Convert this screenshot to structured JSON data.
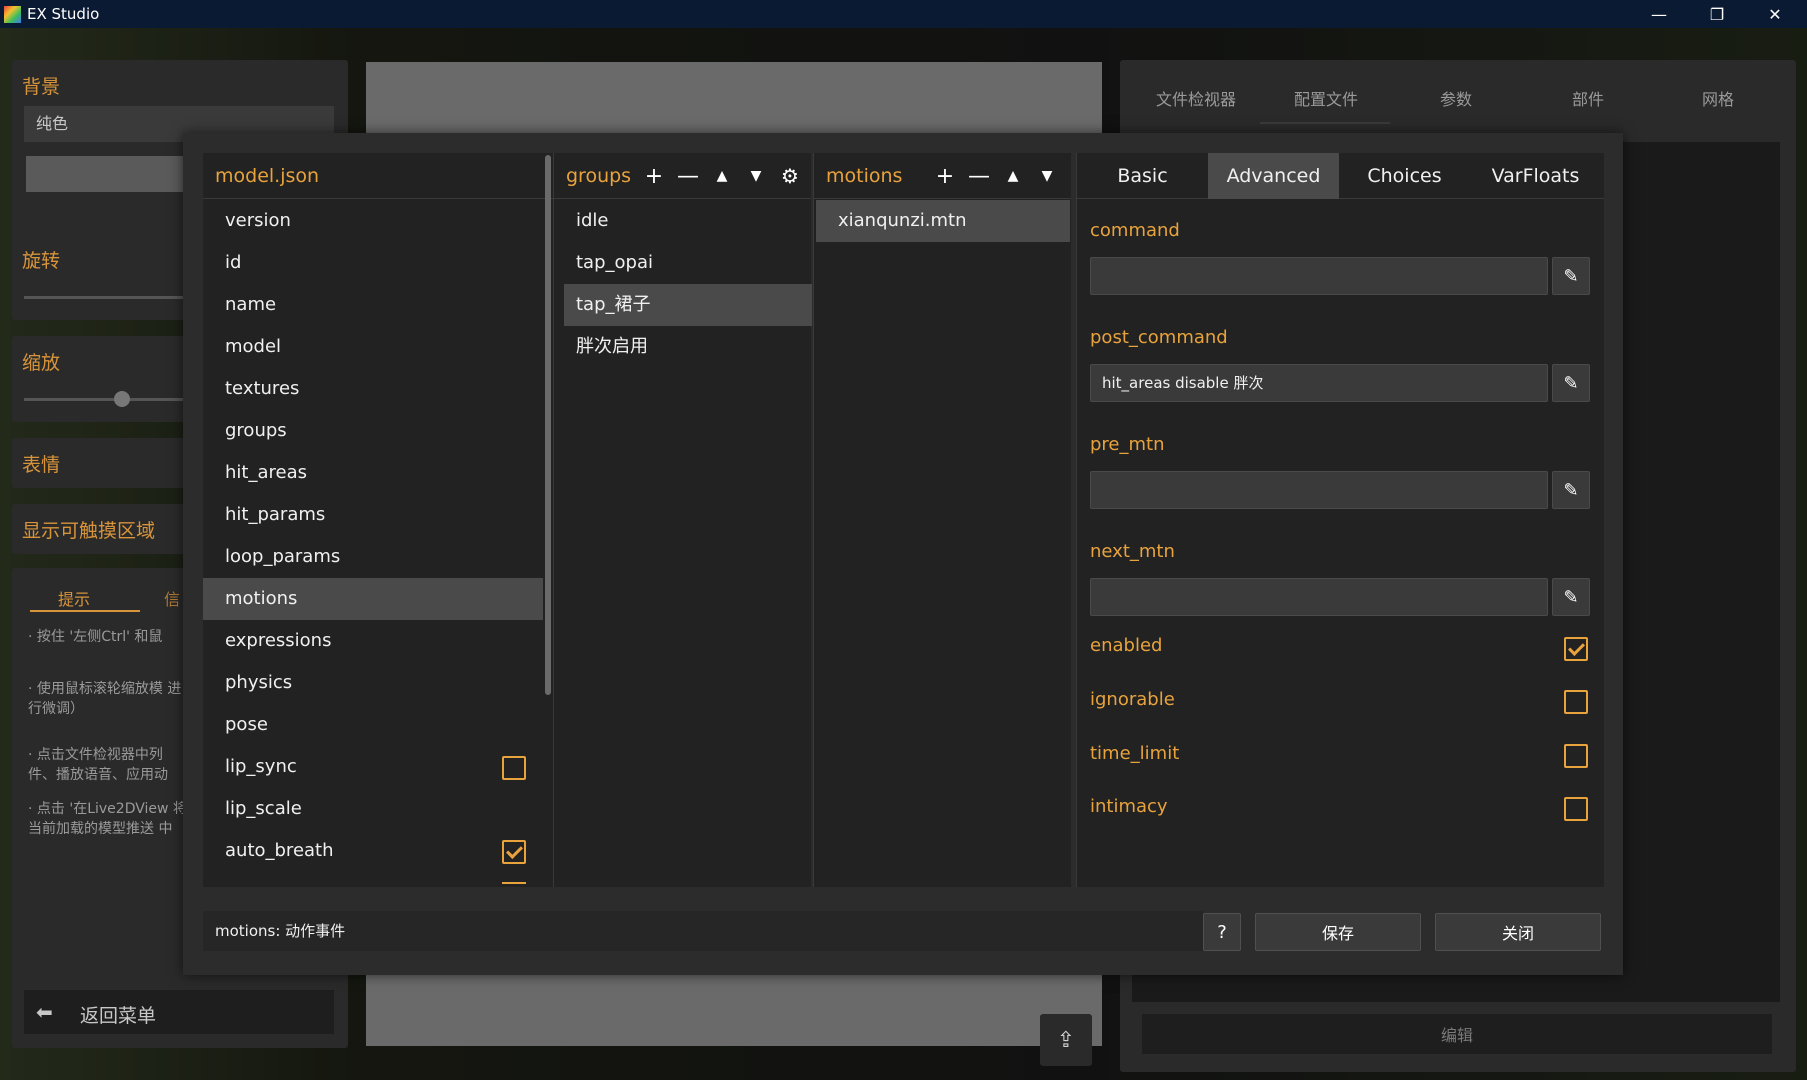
{
  "window": {
    "title": "EX Studio",
    "minimize": "—",
    "restore": "❐",
    "close": "✕"
  },
  "background": {
    "left": {
      "background_title": "背景",
      "background_select": "纯色",
      "rotate_title": "旋转",
      "scale_title": "缩放",
      "expression_title": "表情",
      "show_hit_title": "显示可触摸区域",
      "tips_tab": "提示",
      "info_tab": "信",
      "tips": [
        "· 按住 '左侧Ctrl' 和鼠",
        "· 使用鼠标滚轮缩放模 进行微调）",
        "· 点击文件检视器中列 件、播放语音、应用动",
        "· 点击 '在Live2DView 将当前加载的模型推送 中"
      ],
      "back_menu": "返回菜单"
    },
    "right": {
      "tabs": [
        "文件检视器",
        "配置文件",
        "参数",
        "部件",
        "网格"
      ],
      "edit_button": "编辑"
    }
  },
  "dialog": {
    "model_header": "model.json",
    "model_items": [
      {
        "label": "version"
      },
      {
        "label": "id"
      },
      {
        "label": "name"
      },
      {
        "label": "model"
      },
      {
        "label": "textures"
      },
      {
        "label": "groups"
      },
      {
        "label": "hit_areas"
      },
      {
        "label": "hit_params"
      },
      {
        "label": "loop_params"
      },
      {
        "label": "motions"
      },
      {
        "label": "expressions"
      },
      {
        "label": "physics"
      },
      {
        "label": "pose"
      },
      {
        "label": "lip_sync"
      },
      {
        "label": "lip_scale"
      },
      {
        "label": "auto_breath"
      }
    ],
    "model_selected": "motions",
    "lip_sync_checked": false,
    "auto_breath_checked": true,
    "groups_header": "groups",
    "groups_items": [
      "idle",
      "tap_opai",
      "tap_裙子",
      "胖次启用"
    ],
    "groups_selected": "tap_裙子",
    "motions_header": "motions",
    "motions_items": [
      "xianqunzi.mtn"
    ],
    "motions_selected": "xianqunzi.mtn",
    "tabs": [
      "Basic",
      "Advanced",
      "Choices",
      "VarFloats"
    ],
    "active_tab": "Advanced",
    "fields": {
      "command": {
        "label": "command",
        "value": ""
      },
      "post_command": {
        "label": "post_command",
        "value": "hit_areas disable 胖次"
      },
      "pre_mtn": {
        "label": "pre_mtn",
        "value": ""
      },
      "next_mtn": {
        "label": "next_mtn",
        "value": ""
      }
    },
    "flags": [
      {
        "label": "enabled",
        "checked": true
      },
      {
        "label": "ignorable",
        "checked": false
      },
      {
        "label": "time_limit",
        "checked": false
      },
      {
        "label": "intimacy",
        "checked": false
      }
    ],
    "status": "motions: 动作事件",
    "help_button": "?",
    "save_button": "保存",
    "close_button": "关闭"
  },
  "colors": {
    "accent": "#e8a33d",
    "selected": "#4a4a4a",
    "titlebar": "#0b1a33"
  },
  "icons": [
    "plus-icon",
    "minus-icon",
    "arrow-up-icon",
    "arrow-down-icon",
    "gear-icon",
    "pencil-icon",
    "arrow-left-icon",
    "export-icon"
  ]
}
